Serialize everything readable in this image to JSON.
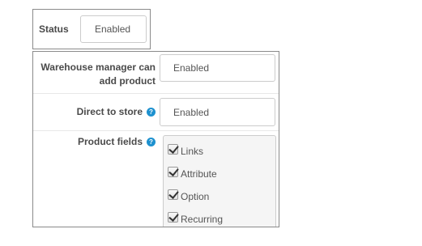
{
  "status": {
    "label": "Status",
    "value": "Enabled"
  },
  "form": {
    "warehouse_add_product": {
      "label": "Warehouse manager can add product",
      "value": "Enabled"
    },
    "direct_to_store": {
      "label": "Direct to store",
      "help_icon": "?",
      "value": "Enabled"
    },
    "product_fields": {
      "label": "Product fields",
      "help_icon": "?",
      "options": [
        {
          "label": "Links",
          "checked": true
        },
        {
          "label": "Attribute",
          "checked": true
        },
        {
          "label": "Option",
          "checked": true
        },
        {
          "label": "Recurring",
          "checked": true
        }
      ]
    }
  },
  "colors": {
    "help_icon": "#1e91cf",
    "border": "#8a8a8a",
    "fields_bg": "#f5f5f5"
  }
}
